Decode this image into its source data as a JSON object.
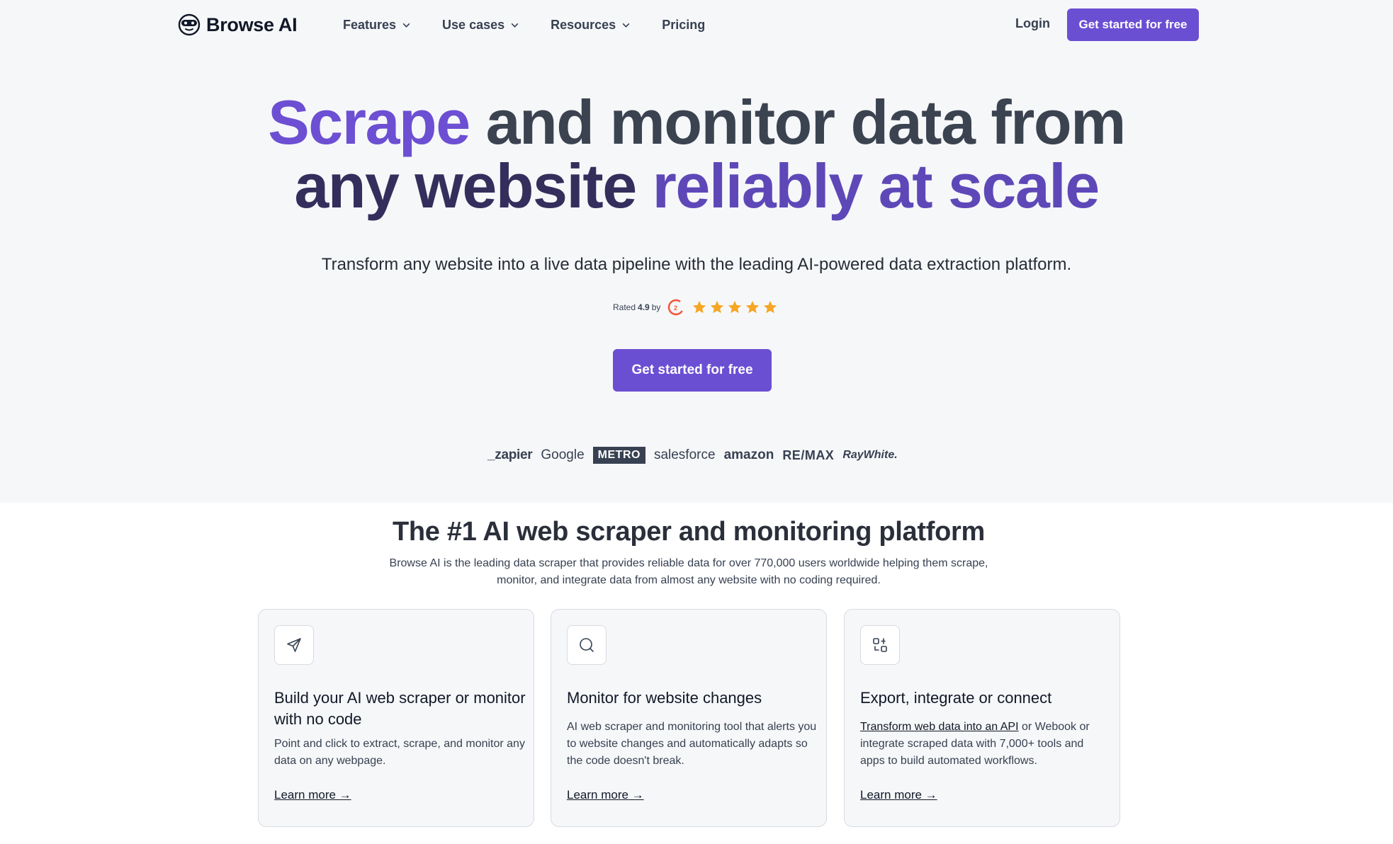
{
  "brand": {
    "name": "Browse AI",
    "accent": "#6b4fd3"
  },
  "nav": {
    "items": [
      {
        "label": "Features",
        "dropdown": true
      },
      {
        "label": "Use cases",
        "dropdown": true
      },
      {
        "label": "Resources",
        "dropdown": true
      },
      {
        "label": "Pricing",
        "dropdown": false
      }
    ],
    "login": "Login",
    "cta": "Get started for free"
  },
  "hero": {
    "title_line1": {
      "w1": "Scrape",
      "w2": "and monitor data from"
    },
    "title_line2": {
      "w1": "any website",
      "w2": "reliably at scale"
    },
    "subtitle": "Transform any website into a live data pipeline with the leading AI-powered data extraction platform.",
    "rating": {
      "prefix": "Rated",
      "score": "4.9",
      "suffix": "by",
      "stars": 5
    },
    "cta": "Get started for free"
  },
  "brands": [
    "_zapier",
    "Google",
    "METRO",
    "salesforce",
    "amazon",
    "RE/MAX",
    "RayWhite."
  ],
  "section": {
    "title": "The #1 AI web scraper and monitoring platform",
    "description": "Browse AI is the leading data scraper that provides reliable data for over 770,000 users worldwide helping them scrape, monitor, and integrate data from almost any website with no coding required."
  },
  "cards": [
    {
      "icon": "send-icon",
      "title": "Build your AI web scraper or monitor with no code",
      "body": "Point and click to extract, scrape, and monitor any data on any webpage.",
      "link": "Learn more →"
    },
    {
      "icon": "search-icon",
      "title": "Monitor for website changes",
      "body": "AI web scraper and monitoring tool that alerts you to website changes and automatically adapts so the code doesn't break.",
      "link": "Learn more →"
    },
    {
      "icon": "integration-icon",
      "title": "Export, integrate or connect",
      "body_link": "Transform web data into an API",
      "body_rest": " or Webook or integrate scraped data with 7,000+ tools and apps to build automated workflows.",
      "link": "Learn more →"
    }
  ]
}
